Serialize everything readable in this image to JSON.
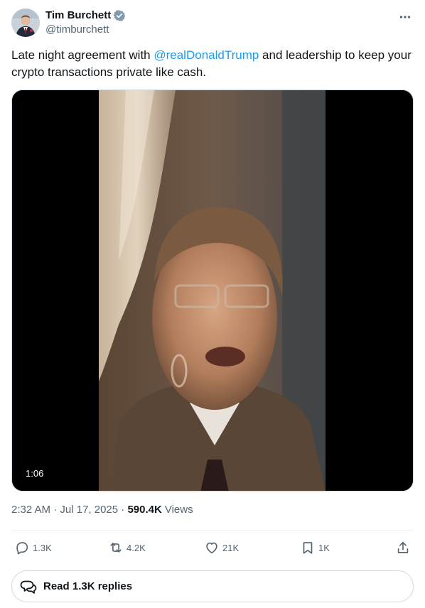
{
  "author": {
    "display_name": "Tim Burchett",
    "handle": "@timburchett"
  },
  "tweet": {
    "text_before": "Late night agreement with ",
    "mention": "@realDonaldTrump",
    "text_after": " and leadership to keep your crypto transactions private like cash."
  },
  "media": {
    "duration": "1:06"
  },
  "meta": {
    "time": "2:32 AM",
    "separator1": " · ",
    "date": "Jul 17, 2025",
    "separator2": " · ",
    "views_count": "590.4K",
    "views_label": "Views"
  },
  "actions": {
    "replies": "1.3K",
    "reposts": "4.2K",
    "likes": "21K",
    "bookmarks": "1K"
  },
  "read_replies": {
    "label": "Read 1.3K replies"
  },
  "colors": {
    "accent": "#1d9bf0",
    "secondary_text": "#536471",
    "primary_text": "#0f1419",
    "border": "#cfd9de"
  },
  "icons": [
    "verified-badge-icon",
    "more-icon",
    "reply-icon",
    "repost-icon",
    "like-icon",
    "bookmark-icon",
    "share-icon",
    "chat-bubbles-icon"
  ]
}
